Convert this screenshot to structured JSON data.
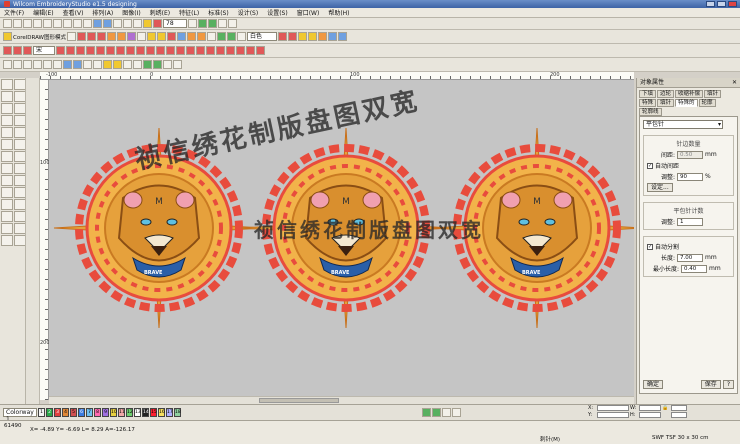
{
  "window": {
    "title": "Wilcom EmbroideryStudio e1.5 designing"
  },
  "menu": [
    "文件(F)",
    "编辑(E)",
    "查看(V)",
    "排列(A)",
    "图像(I)",
    "刺绣(E)",
    "特征(L)",
    "标准(S)",
    "设计(S)",
    "设置(S)",
    "窗口(W)",
    "帮助(H)"
  ],
  "toolbar": {
    "corel_label": "CorelDRAW图形模式",
    "zoom_value": "78",
    "font_combo": "宋",
    "color_combo": "白色"
  },
  "rulers": {
    "h": [
      "-100",
      "0",
      "100",
      "200"
    ],
    "v": [
      "100",
      "200"
    ]
  },
  "watermark": {
    "top": "祯信绣花制版盘图双宽",
    "middle": "祯信绣花制版盘图双宽"
  },
  "lion": {
    "badge": "BRAVE"
  },
  "colors": {
    "canvas": "#c5c5c5",
    "mane_outer": "#e84c3d",
    "mane_inner": "#f0b040",
    "face": "#e0a040",
    "badge": "#2a5fa8"
  },
  "panel": {
    "title": "对象属性",
    "tabs": [
      "下填",
      "边轮",
      "收缩补偿",
      "填针",
      "特殊",
      "填针",
      "特殊的",
      "轮廓",
      "轮廓线"
    ],
    "stitch_type": "平包针",
    "group1_title": "针边数量",
    "spacing_label": "间距:",
    "spacing_value": "0.50",
    "spacing_unit": "mm",
    "auto_spacing_label": "自动间距",
    "adjust_label": "调整:",
    "adjust_value": "90",
    "adjust_unit": "%",
    "settings_btn": "设定...",
    "group2_title": "平包针计数",
    "count_label": "调整:",
    "count_value": "1",
    "auto_split_label": "自动分割",
    "length_label": "长度:",
    "length_value": "7.00",
    "length_unit": "mm",
    "min_length_label": "最小长度:",
    "min_length_value": "0.40",
    "min_length_unit": "mm",
    "btn_ok": "确定",
    "btn_save": "保存",
    "btn_help": "?"
  },
  "colorbar": {
    "colorway": "Colorway 1",
    "chips": [
      "1",
      "2",
      "3",
      "4",
      "5",
      "6",
      "7",
      "8",
      "9",
      "10",
      "11",
      "12",
      "13",
      "14",
      "15",
      "16",
      "17",
      "18"
    ],
    "chip_colors": [
      "#f4f4f4",
      "#2aa84a",
      "#e04040",
      "#e08838",
      "#d05050",
      "#3a7be0",
      "#70c0f0",
      "#ff6ab0",
      "#a070e0",
      "#e8d040",
      "#f0a8a8",
      "#6fd070",
      "#ffffff",
      "#222222",
      "#ff2030",
      "#f7e060",
      "#b0b0ff",
      "#90d0a0"
    ]
  },
  "coords": {
    "w_label": "W:",
    "h_label": "H:",
    "x_label": "X:",
    "y_label": "Y:"
  },
  "status": {
    "stitch_count": "61490",
    "coords": "X= -4.89 Y= -6.69 L= 8.29 A=-126.17",
    "mode": "刺针(M)",
    "hoop": "SWF TSF 30 x 30 cm"
  }
}
